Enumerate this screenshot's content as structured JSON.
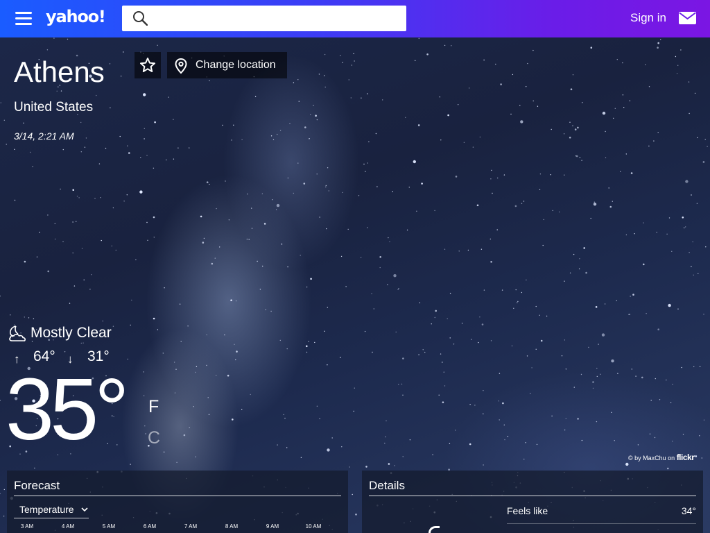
{
  "header": {
    "logo_text": "yahoo!",
    "search": {
      "value": "",
      "placeholder": ""
    },
    "signin_label": "Sign in",
    "icons": {
      "menu": "hamburger-menu-icon",
      "search": "search-icon",
      "mail": "mail-icon"
    }
  },
  "location": {
    "city": "Athens",
    "country": "United States",
    "datetime": "3/14, 2:21 AM",
    "change_location_label": "Change location",
    "icons": {
      "favorite": "star-icon",
      "change": "location-pin-icon"
    }
  },
  "current": {
    "condition": "Mostly Clear",
    "condition_icon": "moon-cloud-icon",
    "high_arrow": "↑",
    "high": "64°",
    "low_arrow": "↓",
    "low": "31°",
    "temperature": "35°",
    "unit_f": "F",
    "unit_c": "C"
  },
  "photo_credit": {
    "prefix": "© by MaxChu on",
    "brand": "flickr"
  },
  "forecast": {
    "title": "Forecast",
    "selector_value": "Temperature",
    "hours": [
      "3 AM",
      "4 AM",
      "5 AM",
      "6 AM",
      "7 AM",
      "8 AM",
      "9 AM",
      "10 AM"
    ]
  },
  "details": {
    "title": "Details",
    "feels_like_label": "Feels like",
    "feels_like_value": "34°"
  },
  "colors": {
    "header_gradient_start": "#1a5cff",
    "header_gradient_end": "#7b16e3",
    "panel_bg": "#141a2c",
    "text": "#ffffff"
  }
}
